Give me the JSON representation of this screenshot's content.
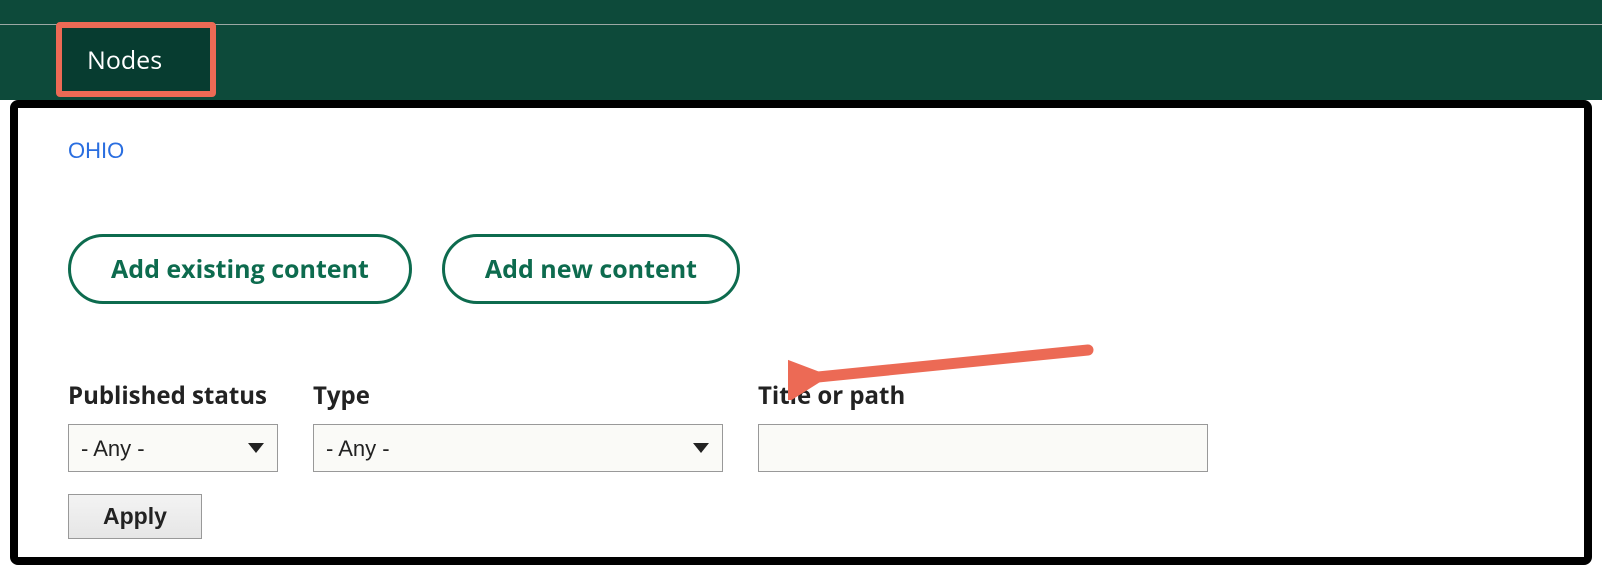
{
  "tabs": {
    "nodes": "Nodes"
  },
  "breadcrumb": {
    "ohio": "OHIO"
  },
  "buttons": {
    "add_existing": "Add existing content",
    "add_new": "Add new content",
    "apply": "Apply"
  },
  "filters": {
    "published_status": {
      "label": "Published status",
      "value": "- Any -"
    },
    "type": {
      "label": "Type",
      "value": "- Any -"
    },
    "title_or_path": {
      "label": "Title or path",
      "value": ""
    }
  },
  "colors": {
    "green_dark": "#0d4a3a",
    "green_accent": "#0d6b4e",
    "highlight_orange": "#ec6a55",
    "link_blue": "#2a6ee0"
  }
}
